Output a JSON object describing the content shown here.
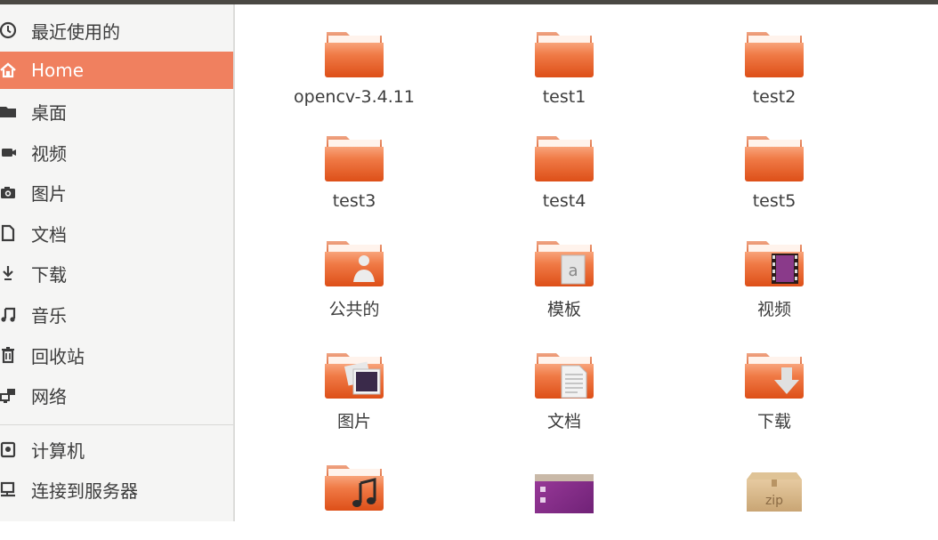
{
  "sidebar": {
    "items": [
      {
        "label": "最近使用的",
        "icon": "clock-icon",
        "active": false
      },
      {
        "label": "Home",
        "icon": "home-icon",
        "active": true
      },
      {
        "label": "桌面",
        "icon": "desktop-folder-icon",
        "active": false
      },
      {
        "label": "视频",
        "icon": "video-camera-icon",
        "active": false
      },
      {
        "label": "图片",
        "icon": "camera-icon",
        "active": false
      },
      {
        "label": "文档",
        "icon": "document-icon",
        "active": false
      },
      {
        "label": "下载",
        "icon": "download-icon",
        "active": false
      },
      {
        "label": "音乐",
        "icon": "music-note-icon",
        "active": false
      },
      {
        "label": "回收站",
        "icon": "trash-icon",
        "active": false
      },
      {
        "label": "网络",
        "icon": "network-icon",
        "active": false
      },
      {
        "label": "计算机",
        "icon": "computer-drive-icon",
        "active": false
      },
      {
        "label": "连接到服务器",
        "icon": "server-connect-icon",
        "active": false
      }
    ]
  },
  "files": [
    {
      "name": "opencv-3.4.11",
      "type": "folder",
      "icon": "folder-icon"
    },
    {
      "name": "test1",
      "type": "folder",
      "icon": "folder-icon"
    },
    {
      "name": "test2",
      "type": "folder",
      "icon": "folder-icon"
    },
    {
      "name": "test3",
      "type": "folder",
      "icon": "folder-icon"
    },
    {
      "name": "test4",
      "type": "folder",
      "icon": "folder-icon"
    },
    {
      "name": "test5",
      "type": "folder",
      "icon": "folder-icon"
    },
    {
      "name": "公共的",
      "type": "folder",
      "icon": "public-folder-icon"
    },
    {
      "name": "模板",
      "type": "folder",
      "icon": "templates-folder-icon"
    },
    {
      "name": "视频",
      "type": "folder",
      "icon": "videos-folder-icon"
    },
    {
      "name": "图片",
      "type": "folder",
      "icon": "pictures-folder-icon"
    },
    {
      "name": "文档",
      "type": "folder",
      "icon": "documents-folder-icon"
    },
    {
      "name": "下载",
      "type": "folder",
      "icon": "downloads-folder-icon"
    },
    {
      "name": "",
      "type": "folder",
      "icon": "music-folder-icon"
    },
    {
      "name": "",
      "type": "file",
      "icon": "desktop-app-icon"
    },
    {
      "name": "",
      "type": "file",
      "icon": "zip-archive-icon"
    }
  ],
  "colors": {
    "accent": "#f0805f",
    "folder_dark": "#e0501c",
    "folder_light": "#f7a27a",
    "sidebar_bg": "#f5f5f4"
  }
}
